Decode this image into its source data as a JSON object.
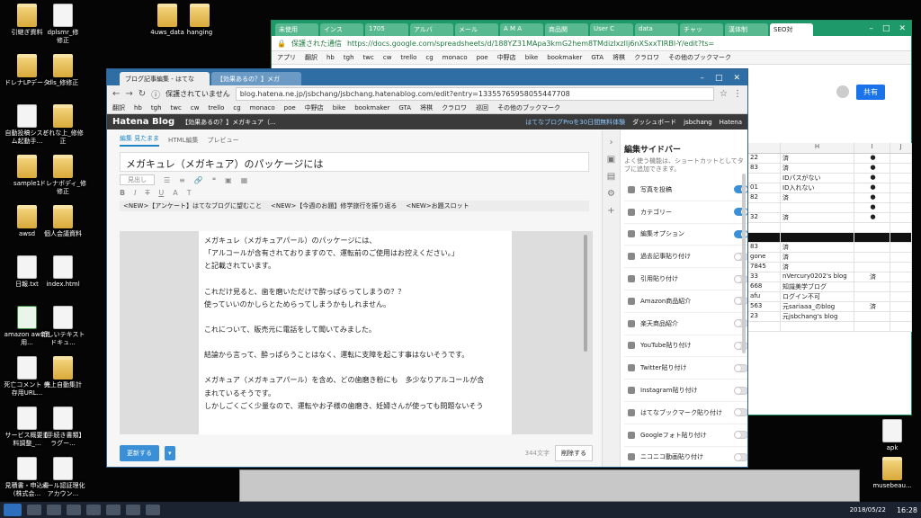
{
  "desktop": {
    "icons_left": [
      {
        "label": "引継ぎ資料",
        "type": "folder"
      },
      {
        "label": "dplsmr_​修\n修正",
        "type": "file"
      },
      {
        "label": "ドレナLPデータ",
        "type": "folder"
      },
      {
        "label": "dls_修修正",
        "type": "folder"
      },
      {
        "label": "自動投稿システム起動手...",
        "type": "file"
      },
      {
        "label": "どれな上_修修正",
        "type": "folder"
      },
      {
        "label": "sample1",
        "type": "folder"
      },
      {
        "label": "ドレナボディ_修修正",
        "type": "folder"
      },
      {
        "label": "awsd",
        "type": "folder"
      },
      {
        "label": "個人会議資料",
        "type": "folder"
      },
      {
        "label": "日報.txt",
        "type": "file"
      },
      {
        "label": "index.html",
        "type": "file"
      },
      {
        "label": "amazon aws使用...",
        "type": "xls"
      },
      {
        "label": "新しいテキスト ドキュ...",
        "type": "file"
      },
      {
        "label": "死亡コメント 保存用URL...",
        "type": "file"
      },
      {
        "label": "売上自動集計",
        "type": "folder"
      },
      {
        "label": "サービス概要資料調整_...",
        "type": "file"
      },
      {
        "label": "【手続き書類】 ラグー...",
        "type": "file"
      },
      {
        "label": "見積書・申込書(株式会...",
        "type": "file"
      },
      {
        "label": "メール認証理化アカウン...",
        "type": "file"
      }
    ],
    "icons_top": [
      {
        "label": "4uws_data"
      },
      {
        "label": "hanging"
      }
    ],
    "icons_right": [
      {
        "label": "apk"
      },
      {
        "label": "musebeau..."
      }
    ]
  },
  "sheet_window": {
    "tabs": [
      "未使用",
      "インス",
      "1705",
      "アルバ",
      "メール",
      "A M A",
      "商品関",
      "User C",
      "data",
      "チャッ",
      "漢体制",
      "SEO対"
    ],
    "url": "https://docs.google.com/spreadsheets/d/188YZ31MApa3kmG2hem8TMdizlxzIlj6nXSxxTIRBl-Y/edit?ts=",
    "secure_label": "保護された通信",
    "bookmarks": [
      "アプリ",
      "翻訳",
      "hb",
      "tgh",
      "twc",
      "cw",
      "trello",
      "cg",
      "monaco",
      "poe",
      "中野店",
      "bike",
      "bookmaker",
      "GTA",
      "将棋",
      "クラロワ",
      "その他のブックマーク"
    ],
    "share_label": "共有",
    "columns": [
      "",
      "H",
      "I",
      "J"
    ],
    "rows": [
      [
        "22",
        "済",
        "●",
        ""
      ],
      [
        "83",
        "済",
        "●",
        ""
      ],
      [
        "",
        "IDパスがない",
        "●",
        ""
      ],
      [
        "01",
        "ID入れない",
        "●",
        ""
      ],
      [
        "82",
        "済",
        "●",
        ""
      ],
      [
        "",
        "",
        "●",
        ""
      ],
      [
        "32",
        "済",
        "●",
        ""
      ],
      [
        "",
        "",
        "",
        ""
      ],
      [
        "",
        "",
        "",
        ""
      ],
      [
        "83",
        "済",
        "",
        ""
      ],
      [
        "gone",
        "済",
        "",
        ""
      ],
      [
        "7845",
        "済",
        "",
        ""
      ],
      [
        "33",
        "nVercury0202's blog",
        "済",
        ""
      ],
      [
        "668",
        "知識美学ブログ",
        "",
        ""
      ],
      [
        "afu",
        "ログイン不可",
        "",
        ""
      ],
      [
        "563",
        "元sariaaa_のblog",
        "済",
        ""
      ],
      [
        "23",
        "元jsbchang's blog",
        "",
        ""
      ],
      [
        "",
        "",
        "",
        ""
      ]
    ]
  },
  "blog_window": {
    "tabs": [
      "ブログ記事編集 - はてな",
      "【効果あるの？】メガ"
    ],
    "security_label": "保護されていません",
    "url": "blog.hatena.ne.jp/jsbchang/jsbchang.hatenablog.com/edit?entry=13355765958055447708",
    "bookmarks": [
      "翻訳",
      "hb",
      "tgh",
      "twc",
      "cw",
      "trello",
      "cg",
      "monaco",
      "poe",
      "中野店",
      "bike",
      "bookmaker",
      "GTA",
      "将棋",
      "クラロワ",
      "巡回",
      "その他のブックマーク"
    ],
    "hatena_bar": {
      "logo": "Hatena Blog",
      "entry": "【効果あるの？】メガキュア（...",
      "pro": "はてなブログProを30日間無料体験",
      "dashboard": "ダッシュボード",
      "user": "jsbchang",
      "brand": "Hatena"
    },
    "mode_tabs": [
      "編集 見たまま",
      "HTML編集",
      "プレビュー"
    ],
    "title": "メガキュレ（メガキュア）のパッケージには",
    "toolbar_style": "見出し",
    "notices": [
      "<NEW>【アンケート】はてなブログに望むこと",
      "<NEW>【今週のお題】修学旅行を振り返る",
      "<NEW>お題スロット"
    ],
    "body_lines": [
      "メガキュレ（メガキュアパール）のパッケージには、",
      "「アルコールが含有されておりますので、運転前のご使用はお控えください。」",
      "と記載されています。",
      "",
      "これだけ見ると、歯を磨いただけで酔っぱらってしまうの？？",
      "使っていいのかしらとためらってしまうかもしれません。",
      "",
      "これについて、販売元に電話をして聞いてみました。",
      "",
      "結論から言って、酔っぱらうことはなく、運転に支障を起こす事はないそうです。",
      "",
      "メガキュア（メガキュアパール）を含め、どの歯磨き粉にも　多少なりアルコールが含",
      "まれているそうです。",
      "しかしごくごく少量なので、運転やお子様の歯磨き、妊婦さんが使っても問題ないそう"
    ],
    "update_label": "更新する",
    "char_count": "344文字",
    "delete_label": "削除する",
    "sidebar": {
      "title": "編集サイドバー",
      "subtitle": "よく使う機能は、ショートカットとしてタブに追加できます。",
      "items": [
        {
          "label": "写真を投稿",
          "on": true
        },
        {
          "label": "カテゴリー",
          "on": true
        },
        {
          "label": "編集オプション",
          "on": true
        },
        {
          "label": "過去記事貼り付け",
          "on": false
        },
        {
          "label": "引用貼り付け",
          "on": false
        },
        {
          "label": "Amazon商品紹介",
          "on": false
        },
        {
          "label": "楽天商品紹介",
          "on": false
        },
        {
          "label": "YouTube貼り付け",
          "on": false
        },
        {
          "label": "Twitter貼り付け",
          "on": false
        },
        {
          "label": "Instagram貼り付け",
          "on": false
        },
        {
          "label": "はてなブックマーク貼り付け",
          "on": false
        },
        {
          "label": "Googleフォト貼り付け",
          "on": false
        },
        {
          "label": "ニコニコ動画貼り付け",
          "on": false
        }
      ]
    }
  },
  "taskbar": {
    "clock": "16:28",
    "date": "2018/05/22"
  }
}
